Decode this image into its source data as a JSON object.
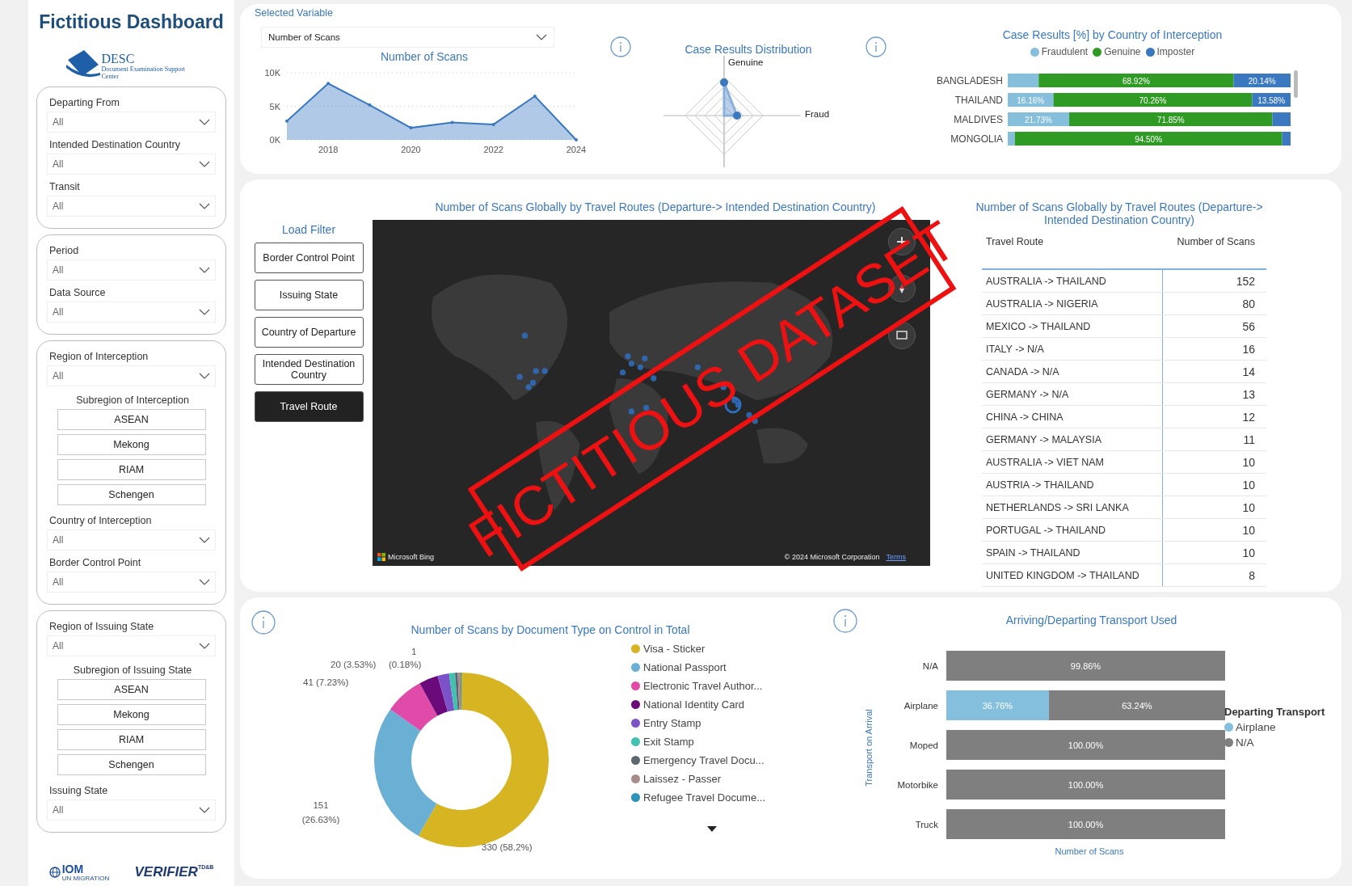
{
  "sidebar": {
    "title": "Fictitious Dashboard",
    "logo": {
      "name": "DESC",
      "subtitle": "Document Examination Support Center"
    },
    "groups": [
      {
        "items": [
          {
            "kind": "dropdown",
            "label": "Departing From",
            "value": "All"
          },
          {
            "kind": "dropdown",
            "label": "Intended Destination Country",
            "value": "All"
          },
          {
            "kind": "dropdown",
            "label": "Transit",
            "value": "All"
          }
        ]
      },
      {
        "items": [
          {
            "kind": "dropdown",
            "label": "Period",
            "value": "All"
          },
          {
            "kind": "dropdown",
            "label": "Data Source",
            "value": "All"
          }
        ]
      },
      {
        "items": [
          {
            "kind": "dropdown",
            "label": "Region of Interception",
            "value": "All"
          },
          {
            "kind": "buttons",
            "label": "Subregion of Interception",
            "options": [
              {
                "label": "ASEAN",
                "selected": false
              },
              {
                "label": "Mekong",
                "selected": false
              },
              {
                "label": "RIAM",
                "selected": false
              },
              {
                "label": "Schengen",
                "selected": false
              }
            ]
          },
          {
            "kind": "dropdown",
            "label": "Country of Interception",
            "value": "All"
          },
          {
            "kind": "dropdown",
            "label": "Border Control Point",
            "value": "All"
          }
        ]
      },
      {
        "items": [
          {
            "kind": "dropdown",
            "label": "Region of Issuing State",
            "value": "All"
          },
          {
            "kind": "buttons",
            "label": "Subregion of Issuing State",
            "options": [
              {
                "label": "ASEAN",
                "selected": false
              },
              {
                "label": "Mekong",
                "selected": false
              },
              {
                "label": "RIAM",
                "selected": false
              },
              {
                "label": "Schengen",
                "selected": false
              }
            ]
          },
          {
            "kind": "dropdown",
            "label": "Issuing State",
            "value": "All"
          }
        ]
      }
    ],
    "footer": {
      "iom": "IOM",
      "iom_sub": "UN MIGRATION",
      "verifier": "VERIFIER",
      "verifier_sup": "TD&B"
    }
  },
  "top": {
    "selector": {
      "label": "Selected Variable",
      "value": "Number of Scans"
    },
    "scans_chart": {
      "chart_data": {
        "type": "area",
        "title": "Number of Scans",
        "x": [
          2017,
          2018,
          2019,
          2020,
          2021,
          2022,
          2023,
          2024
        ],
        "values": [
          2800,
          8400,
          5200,
          1800,
          2600,
          2300,
          6500,
          0
        ],
        "xlim": [
          2017,
          2024
        ],
        "ylim": [
          0,
          10000
        ],
        "xticks": [
          2018,
          2020,
          2022,
          2024
        ],
        "yticks": [
          {
            "value": 0,
            "label": "0K"
          },
          {
            "value": 5000,
            "label": "5K"
          },
          {
            "value": 10000,
            "label": "10K"
          }
        ]
      }
    },
    "radar": {
      "title": "Case Results Distribution",
      "axis_labels": [
        "Genuine",
        "Fraud"
      ]
    },
    "case_results": {
      "chart_data": {
        "type": "bar",
        "orientation": "horizontal",
        "stacked": true,
        "title": "Case Results [%] by Country of Interception",
        "categories": [
          "BANGLADESH",
          "THAILAND",
          "MALDIVES",
          "MONGOLIA"
        ],
        "series": [
          {
            "name": "Fraudulent",
            "color": "#85bfdc",
            "values": [
              10.94,
              16.16,
              21.73,
              2.5
            ],
            "value_labels": [
              null,
              "16.16%",
              "21.73%",
              null
            ]
          },
          {
            "name": "Genuine",
            "color": "#2f9a24",
            "values": [
              68.92,
              70.26,
              71.85,
              94.5
            ],
            "value_labels": [
              "68.92%",
              "70.26%",
              "71.85%",
              "94.50%"
            ]
          },
          {
            "name": "Imposter",
            "color": "#3a78c0",
            "values": [
              20.14,
              13.58,
              6.42,
              3.0
            ],
            "value_labels": [
              "20.14%",
              "13.58%",
              null,
              null
            ]
          }
        ]
      }
    }
  },
  "middle": {
    "load_filter": {
      "title": "Load Filter",
      "buttons": [
        {
          "label": "Border Control Point",
          "selected": false
        },
        {
          "label": "Issuing State",
          "selected": false
        },
        {
          "label": "Country of Departure",
          "selected": false
        },
        {
          "label": "Intended Destination Country",
          "selected": false
        },
        {
          "label": "Travel Route",
          "selected": true
        }
      ]
    },
    "map": {
      "title": "Number of Scans Globally by Travel Routes (Departure-> Intended Destination Country)",
      "brand": "Microsoft Bing",
      "attribution": "© 2024 Microsoft Corporation",
      "terms": "Terms"
    },
    "routes_table": {
      "title": "Number of Scans Globally by Travel Routes (Departure-> Intended Destination Country)",
      "columns": [
        "Travel Route",
        "Number of Scans"
      ],
      "rows": [
        [
          "AUSTRALIA -> THAILAND",
          "152"
        ],
        [
          "AUSTRALIA -> NIGERIA",
          "80"
        ],
        [
          "MEXICO -> THAILAND",
          "56"
        ],
        [
          "ITALY -> N/A",
          "16"
        ],
        [
          "CANADA -> N/A",
          "14"
        ],
        [
          "GERMANY -> N/A",
          "13"
        ],
        [
          "CHINA -> CHINA",
          "12"
        ],
        [
          "GERMANY -> MALAYSIA",
          "11"
        ],
        [
          "AUSTRALIA -> VIET NAM",
          "10"
        ],
        [
          "AUSTRIA -> THAILAND",
          "10"
        ],
        [
          "NETHERLANDS -> SRI LANKA",
          "10"
        ],
        [
          "PORTUGAL -> THAILAND",
          "10"
        ],
        [
          "SPAIN -> THAILAND",
          "10"
        ],
        [
          "UNITED KINGDOM -> THAILAND",
          "8"
        ]
      ]
    }
  },
  "bottom": {
    "documents": {
      "chart_data": {
        "type": "donut",
        "title": "Number of Scans by Document Type on Control in Total",
        "categories": [
          "Visa - Sticker",
          "National Passport",
          "Electronic Travel Author...",
          "National Identity Card",
          "Entry Stamp",
          "Exit Stamp",
          "Emergency Travel Docu...",
          "Laissez - Passer",
          "Refugee Travel Docume..."
        ],
        "values": [
          58.2,
          26.63,
          7.23,
          3.53,
          2.13,
          1.1,
          0.5,
          0.5,
          0.18
        ],
        "colors": [
          "#d6b422",
          "#6ab0d4",
          "#e04aa8",
          "#6b0a7a",
          "#7b52c8",
          "#41c2b0",
          "#5b6770",
          "#a88c8c",
          "#2b94b8"
        ]
      },
      "labels": [
        "1",
        "(0.18%)",
        "20 (3.53%)",
        "41 (7.23%)",
        "151 (26.63%)",
        "330 (58.2%)"
      ]
    },
    "transport": {
      "chart_data": {
        "type": "bar",
        "orientation": "horizontal",
        "stacked": true,
        "title": "Arriving/Departing Transport Used",
        "xlabel": "Number of Scans",
        "ylabel": "Transport on Arrival",
        "categories": [
          "N/A",
          "Airplane",
          "Moped",
          "Motorbike",
          "Truck"
        ],
        "series": [
          {
            "name": "Airplane",
            "color": "#84bfdd",
            "values": [
              null,
              36.76,
              null,
              null,
              null
            ],
            "value_labels": [
              null,
              "36.76%",
              null,
              null,
              null
            ]
          },
          {
            "name": "N/A",
            "color": "#7f7f7f",
            "values": [
              99.86,
              63.24,
              100,
              100,
              100
            ],
            "value_labels": [
              "99.86%",
              "63.24%",
              "100.00%",
              "100.00%",
              "100.00%"
            ]
          }
        ]
      },
      "legend_title": "Departing Transport"
    }
  },
  "stamp": "FICTITIOUS DATASET"
}
